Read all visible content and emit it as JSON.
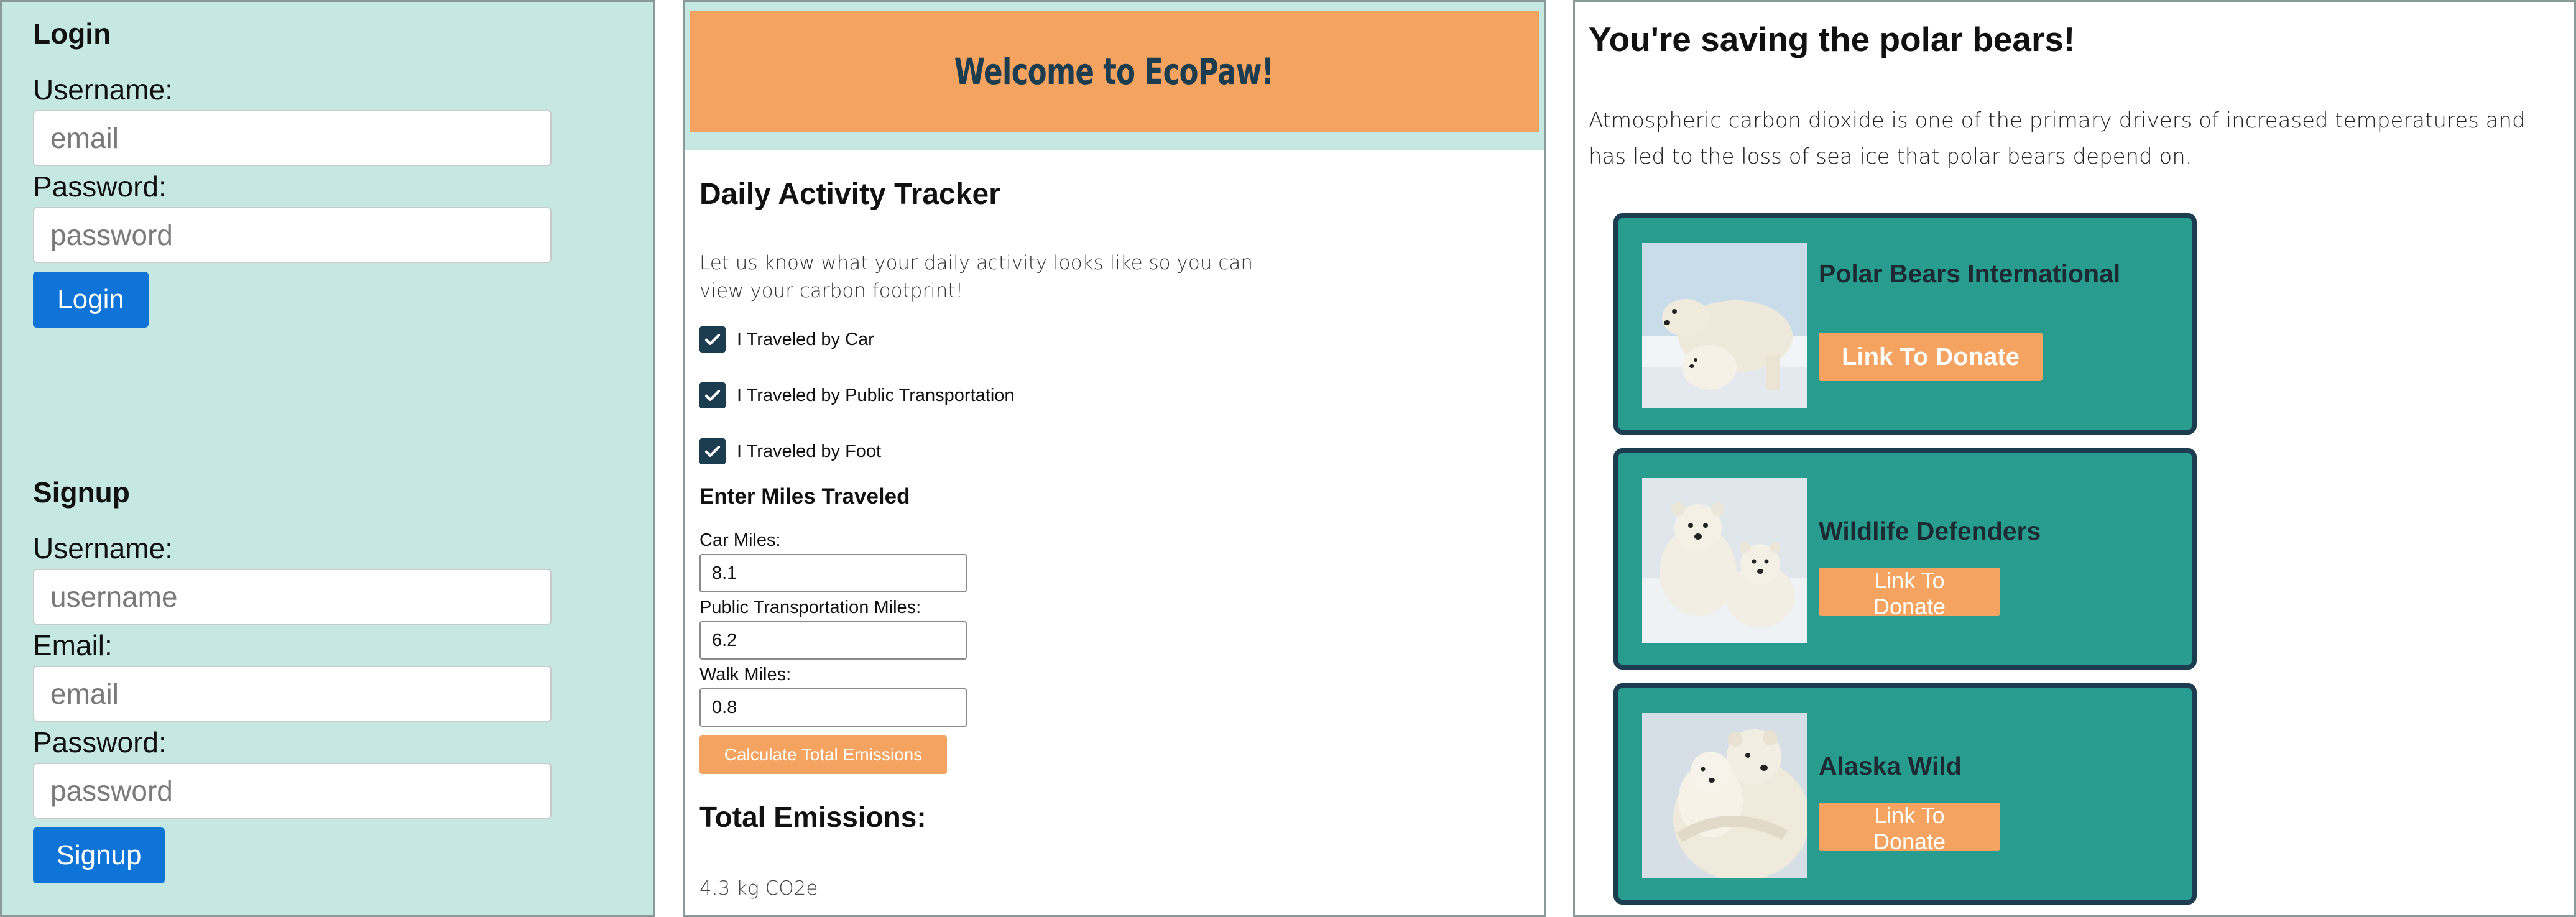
{
  "login": {
    "heading": "Login",
    "username_label": "Username:",
    "username_placeholder": "email",
    "password_label": "Password:",
    "password_placeholder": "password",
    "button_label": "Login"
  },
  "signup": {
    "heading": "Signup",
    "username_label": "Username:",
    "username_placeholder": "username",
    "email_label": "Email:",
    "email_placeholder": "email",
    "password_label": "Password:",
    "password_placeholder": "password",
    "button_label": "Signup"
  },
  "tracker": {
    "banner": "Welcome to EcoPaw!",
    "heading": "Daily Activity Tracker",
    "description": "Let us know what your daily activity looks like so you can view your carbon footprint!",
    "checkboxes": [
      {
        "label": "I Traveled by Car",
        "checked": true
      },
      {
        "label": "I Traveled by Public Transportation",
        "checked": true
      },
      {
        "label": "I Traveled by Foot",
        "checked": true
      }
    ],
    "miles_heading": "Enter Miles Traveled",
    "fields": [
      {
        "label": "Car Miles:",
        "value": "8.1"
      },
      {
        "label": "Public Transportation Miles:",
        "value": "6.2"
      },
      {
        "label": "Walk Miles:",
        "value": "0.8"
      }
    ],
    "calculate_label": "Calculate Total Emissions",
    "total_heading": "Total Emissions:",
    "total_value": "4.3 kg CO2e"
  },
  "bears": {
    "title": "You're saving the polar bears!",
    "description": "Atmospheric carbon dioxide is one of the primary drivers of increased temperatures and has led to the loss of sea ice that polar bears depend on.",
    "organizations": [
      {
        "name": "Polar Bears International",
        "button_label": "Link To Donate"
      },
      {
        "name": "Wildlife Defenders",
        "button_label": "Link To Donate"
      },
      {
        "name": "Alaska Wild",
        "button_label": "Link To Donate"
      }
    ]
  },
  "colors": {
    "auth_bg": "#c6e8e3",
    "primary_blue": "#0f74d8",
    "accent_orange": "#f4a460",
    "dark_navy": "#1c3d50",
    "card_teal": "#289d8f"
  }
}
